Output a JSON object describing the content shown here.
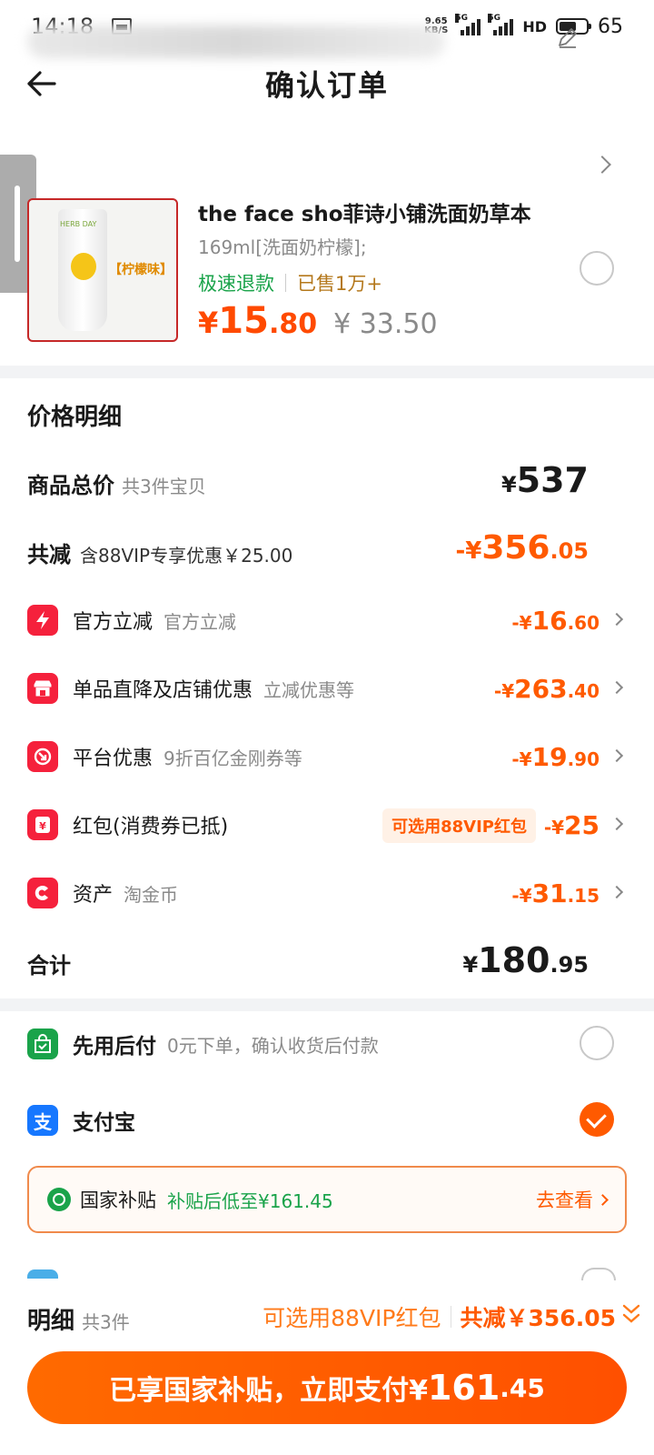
{
  "status": {
    "time": "14:18",
    "net_speed_top": "9.65",
    "net_speed_bottom": "KB/S",
    "sig_label_1": "5G",
    "sig_label_2": "5G",
    "hd": "HD",
    "battery": "65"
  },
  "header": {
    "title": "确认订单"
  },
  "product": {
    "name": "the face sho菲诗小铺洗面奶草本",
    "spec": "169ml[洗面奶柠檬];",
    "tag_refund": "极速退款",
    "tag_sold": "已售1万+",
    "flavor": "【柠檬味】",
    "tube_text": "HERB DAY",
    "price_yen": "¥",
    "price_int": "15",
    "price_dec": ".80",
    "price_old": "¥ 33.50"
  },
  "price_detail": {
    "title": "价格明细",
    "total_label": "商品总价",
    "total_sub": "共3件宝贝",
    "total_yen": "¥",
    "total_amount": "537",
    "reduce_label": "共减",
    "reduce_sub": "含88VIP专享优惠￥25.00",
    "reduce_prefix": "-¥",
    "reduce_int": "356",
    "reduce_dec": ".05",
    "items": [
      {
        "name": "官方立减",
        "desc": "官方立减",
        "prefix": "-¥",
        "int": "16",
        "dec": ".60"
      },
      {
        "name": "单品直降及店铺优惠",
        "desc": "立减优惠等",
        "prefix": "-¥",
        "int": "263",
        "dec": ".40"
      },
      {
        "name": "平台优惠",
        "desc": "9折百亿金刚券等",
        "prefix": "-¥",
        "int": "19",
        "dec": ".90"
      },
      {
        "name": "红包(消费券已抵)",
        "chip": "可选用88VIP红包",
        "prefix": "-¥",
        "int": "25",
        "dec": ""
      },
      {
        "name": "资产",
        "desc": "淘金币",
        "prefix": "-¥",
        "int": "31",
        "dec": ".15"
      }
    ],
    "sum_label": "合计",
    "sum_yen": "¥",
    "sum_int": "180",
    "sum_dec": ".95"
  },
  "payment": {
    "later_name": "先用后付",
    "later_desc": "0元下单，确认收货后付款",
    "alipay_name": "支付宝",
    "alipay_icon": "支",
    "subsidy_title": "国家补贴",
    "subsidy_desc": "补贴后低至¥161.45",
    "subsidy_link": "去查看"
  },
  "footer": {
    "label": "明细",
    "count": "共3件",
    "vip": "可选用88VIP红包",
    "total": "共减￥356.05",
    "button_prefix": "已享国家补贴，立即支付¥",
    "button_int": "161",
    "button_dec": ".45"
  },
  "colors": {
    "accent": "#ff5a00",
    "green": "#1aa34a",
    "red_icon": "#f5213c",
    "alipay_blue": "#1677ff"
  }
}
